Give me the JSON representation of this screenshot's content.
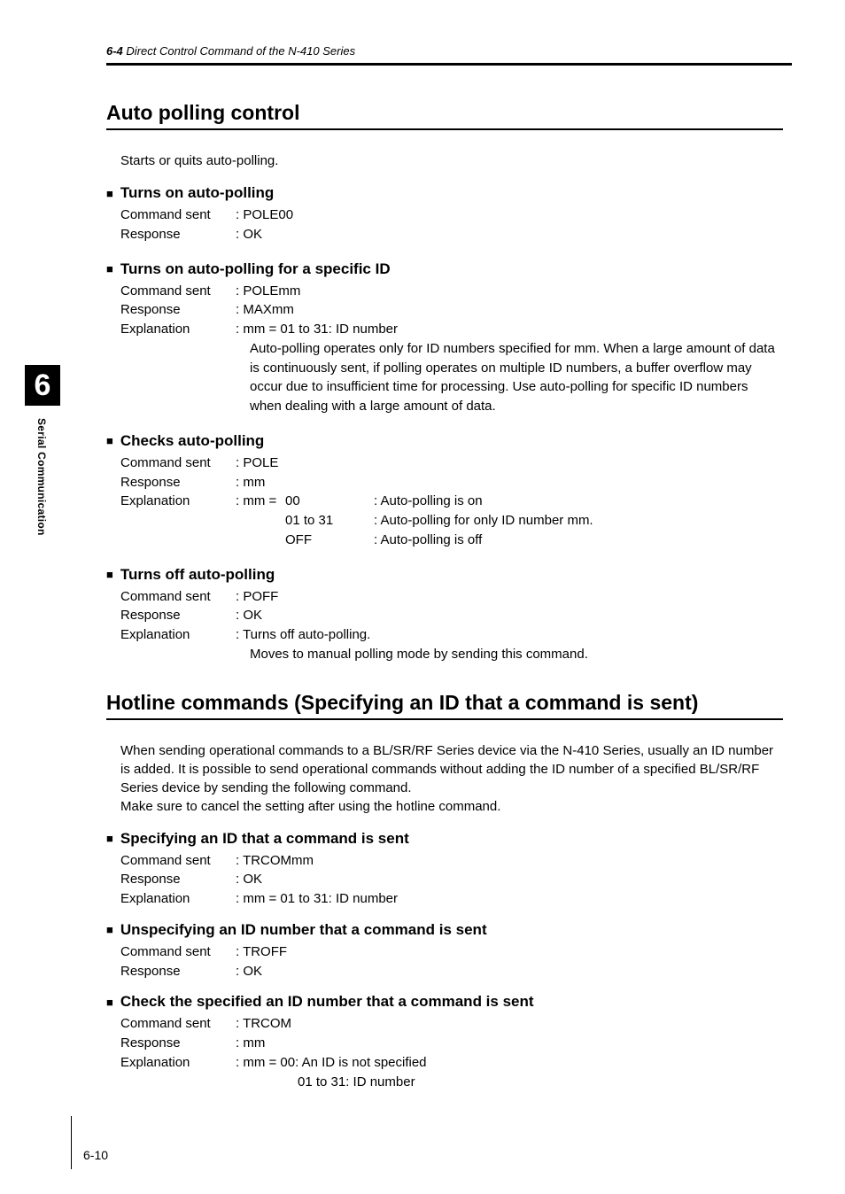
{
  "header": {
    "prefix": "6-4",
    "title": "Direct Control Command of the N-410 Series"
  },
  "tab": {
    "number": "6",
    "label": "Serial Communication"
  },
  "section1": {
    "title": "Auto polling control",
    "intro": "Starts or quits auto-polling.",
    "sub1": {
      "title": "Turns on auto-polling",
      "cmd_label": "Command sent",
      "cmd_value": ": POLE00",
      "resp_label": "Response",
      "resp_value": ": OK"
    },
    "sub2": {
      "title": "Turns on auto-polling for a specific ID",
      "cmd_label": "Command sent",
      "cmd_value": ": POLEmm",
      "resp_label": "Response",
      "resp_value": ": MAXmm",
      "exp_label": "Explanation",
      "exp_value": ": mm = 01 to 31: ID number",
      "exp_body": "Auto-polling operates only for ID numbers specified for mm. When a large amount of data is continuously sent, if polling operates on multiple ID numbers, a buffer overflow may occur due to insufficient time for processing. Use auto-polling for specific ID numbers when dealing with a large amount of data."
    },
    "sub3": {
      "title": "Checks auto-polling",
      "cmd_label": "Command sent",
      "cmd_value": ": POLE",
      "resp_label": "Response",
      "resp_value": ": mm",
      "exp_label": "Explanation",
      "exp_prefix": ": mm =",
      "row1a": "00",
      "row1b": ": Auto-polling is on",
      "row2a": "01 to 31",
      "row2b": ": Auto-polling for only ID number mm.",
      "row3a": "OFF",
      "row3b": ": Auto-polling is off"
    },
    "sub4": {
      "title": "Turns off auto-polling",
      "cmd_label": "Command sent",
      "cmd_value": ": POFF",
      "resp_label": "Response",
      "resp_value": ": OK",
      "exp_label": "Explanation",
      "exp_value": ": Turns off auto-polling.",
      "exp_body": "Moves to manual polling mode by sending this command."
    }
  },
  "section2": {
    "title": "Hotline commands (Specifying an ID that a command is sent)",
    "intro": "When sending operational commands to a BL/SR/RF Series device via the N-410 Series, usually an ID number is added. It is possible to send operational commands without adding the ID number of a specified BL/SR/RF Series device by sending the following command.\nMake sure to cancel the setting after using the hotline command.",
    "sub1": {
      "title": "Specifying an ID that a command is sent",
      "cmd_label": "Command sent",
      "cmd_value": ": TRCOMmm",
      "resp_label": "Response",
      "resp_value": ": OK",
      "exp_label": "Explanation",
      "exp_value": ": mm = 01 to 31: ID number"
    },
    "sub2": {
      "title": "Unspecifying an ID number that a command is sent",
      "cmd_label": "Command sent",
      "cmd_value": ": TROFF",
      "resp_label": "Response",
      "resp_value": ": OK"
    },
    "sub3": {
      "title": "Check the specified an ID number that a command is sent",
      "cmd_label": "Command sent",
      "cmd_value": ": TRCOM",
      "resp_label": "Response",
      "resp_value": ": mm",
      "exp_label": "Explanation",
      "exp_value": ": mm = 00: An ID is not specified",
      "exp_body": "01 to 31: ID number"
    }
  },
  "page_number": "6-10"
}
